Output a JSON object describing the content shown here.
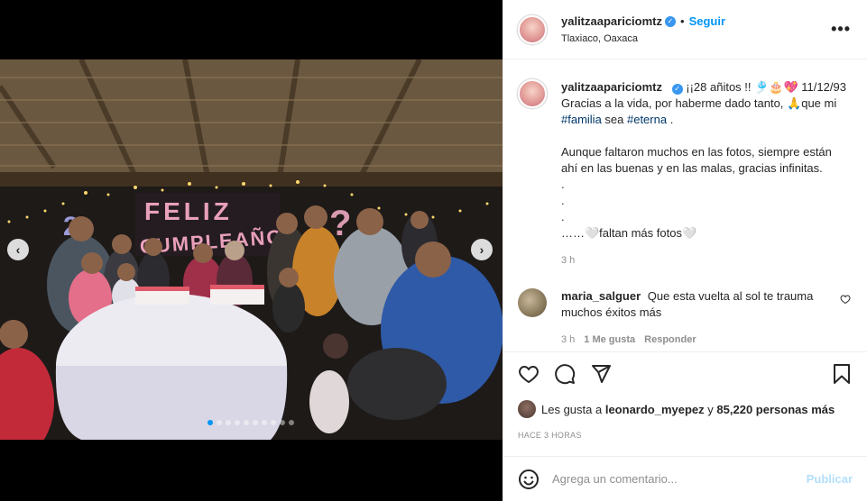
{
  "header": {
    "username": "yalitzaapariciomtz",
    "separator": "•",
    "follow_label": "Seguir",
    "location": "Tlaxiaco, Oaxaca",
    "more_label": "•••"
  },
  "caption": {
    "username": "yalitzaapariciomtz",
    "line1_rest": "¡¡28 añitos !! 🎐🎂💖 11/12/93",
    "line2": "Gracias a la vida, por haberme dado tanto, 🙏que mi",
    "hashtag1": "#familia",
    "word_sea": " sea ",
    "hashtag2": "#eterna",
    "period": " .",
    "paragraph2": "Aunque faltaron muchos en las fotos, siempre están ahí en las buenas y en las malas, gracias infinitas.",
    "dot1": ".",
    "dot2": ".",
    "dot3": ".",
    "last_line": "……🤍faltan más fotos🤍",
    "time": "3 h"
  },
  "comment": {
    "username": "maria_salguer",
    "text": "Que esta vuelta al sol te trauma muchos éxitos más",
    "time": "3 h",
    "likes": "1 Me gusta",
    "reply": "Responder"
  },
  "likes": {
    "prefix": "Les gusta a",
    "user": "leonardo_myepez",
    "connector": "y",
    "count": "85,220 personas más"
  },
  "time_ago": "HACE 3 HORAS",
  "add_comment": {
    "placeholder": "Agrega un comentario...",
    "publish_label": "Publicar"
  },
  "photo": {
    "banner_text": "FELIZ CUMPLEAÑO"
  },
  "carousel": {
    "total_slides": 10,
    "active_index": 0
  },
  "colors": {
    "link_blue": "#0095f6",
    "hashtag": "#00376b",
    "muted": "#8e8e8e",
    "publish_disabled": "#b2dffc"
  }
}
